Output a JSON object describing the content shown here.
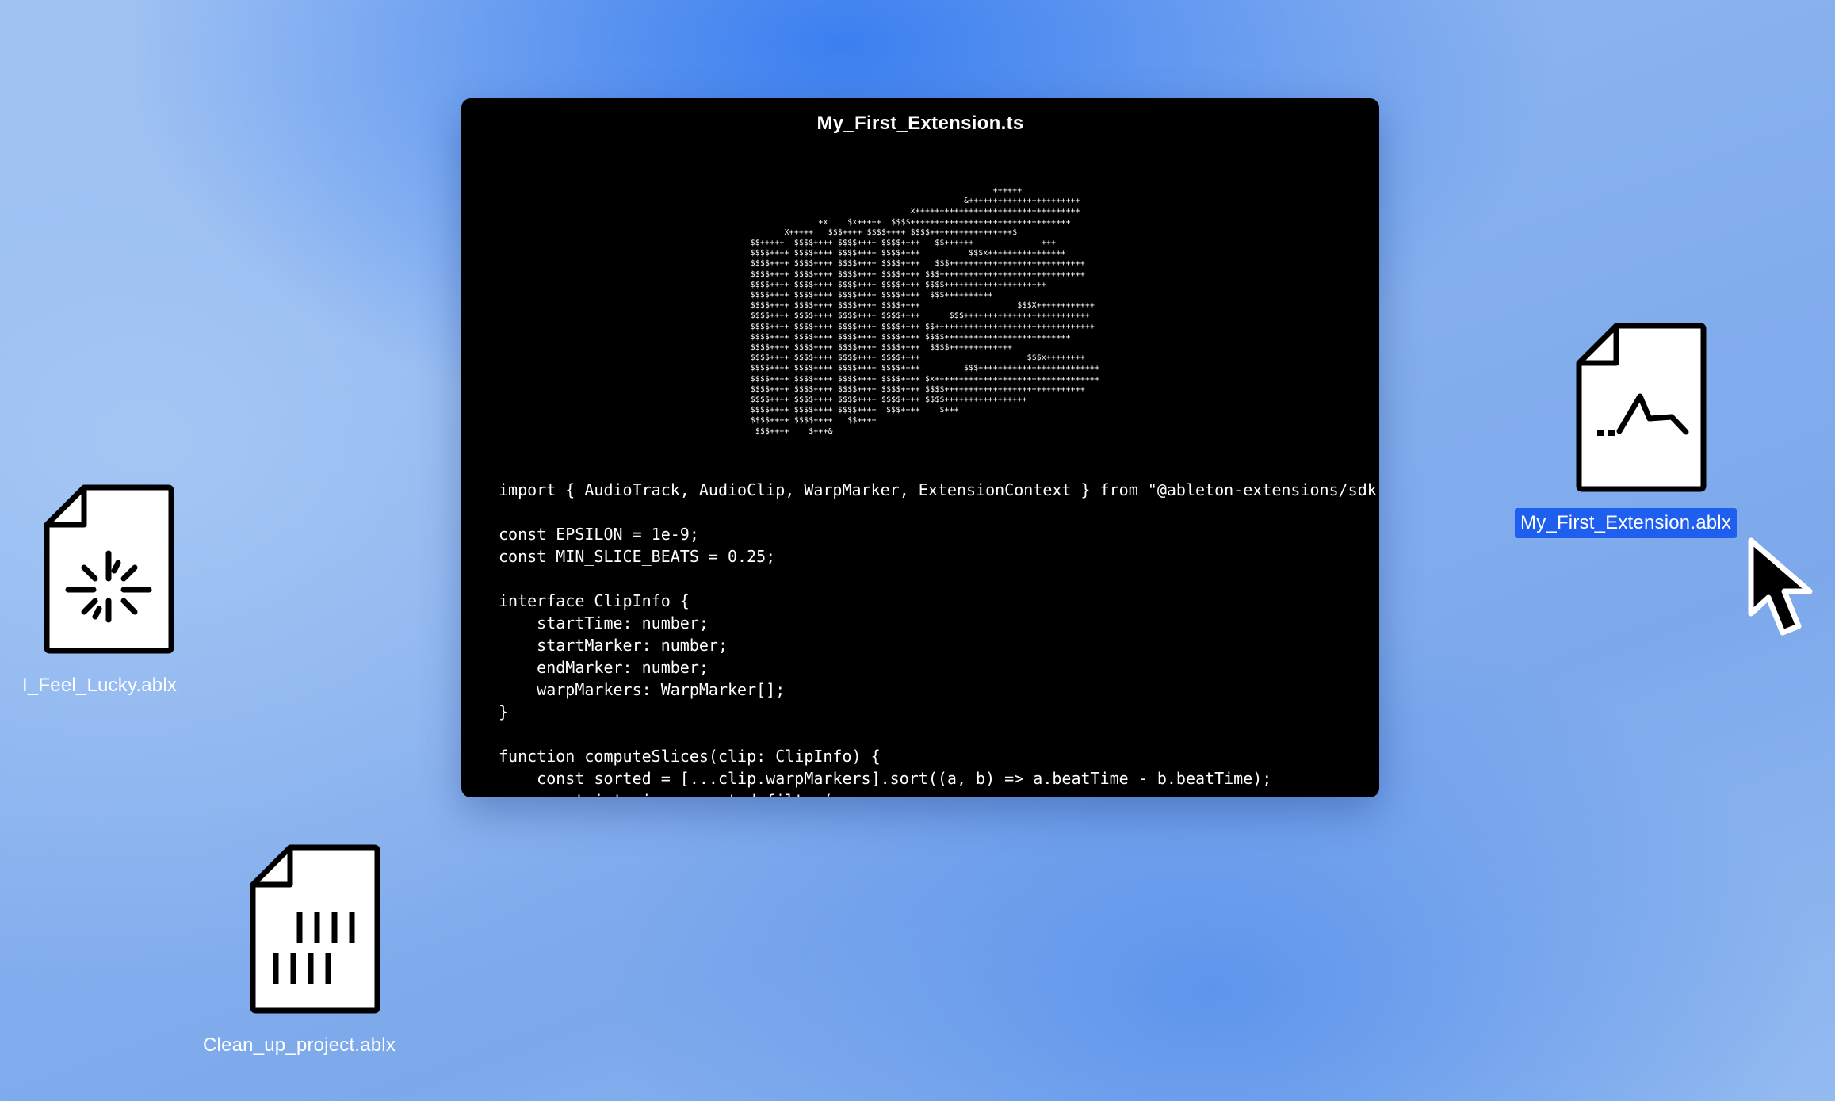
{
  "window": {
    "title": "My_First_Extension.ts",
    "ascii_art": "                                                    ++++++\n                                              &+++++++++++++++++++++++\n                                   x++++++++++++++++++++++++++++++++++\n                +x    $x+++++  $$$$+++++++++++++++++++++++++++++++++\n         X+++++   $$$++++ $$$$++++ $$$$+++++++++++++++++$\n  $$+++++  $$$$++++ $$$$++++ $$$$++++   $$++++++              +++\n  $$$$++++ $$$$++++ $$$$++++ $$$$++++          $$$x++++++++++++++++\n  $$$$++++ $$$$++++ $$$$++++ $$$$++++   $$$++++++++++++++++++++++++++++\n  $$$$++++ $$$$++++ $$$$++++ $$$$++++ $$$++++++++++++++++++++++++++++++\n  $$$$++++ $$$$++++ $$$$++++ $$$$++++ $$$$+++++++++++++++++++++\n  $$$$++++ $$$$++++ $$$$++++ $$$$++++  $$$++++++++++\n  $$$$++++ $$$$++++ $$$$++++ $$$$++++                    $$$X++++++++++++\n  $$$$++++ $$$$++++ $$$$++++ $$$$++++      $$$++++++++++++++++++++++++++\n  $$$$++++ $$$$++++ $$$$++++ $$$$++++ $$+++++++++++++++++++++++++++++++++\n  $$$$++++ $$$$++++ $$$$++++ $$$$++++ $$$$++++++++++++++++++++++++++\n  $$$$++++ $$$$++++ $$$$++++ $$$$++++  $$$$+++++++++++++\n  $$$$++++ $$$$++++ $$$$++++ $$$$++++                      $$$x++++++++\n  $$$$++++ $$$$++++ $$$$++++ $$$$++++         $$$+++++++++++++++++++++++++\n  $$$$++++ $$$$++++ $$$$++++ $$$$++++ $x++++++++++++++++++++++++++++++++++\n  $$$$++++ $$$$++++ $$$$++++ $$$$++++ $$$$+++++++++++++++++++++++++++++\n  $$$$++++ $$$$++++ $$$$++++ $$$$++++ $$$$+++++++++++++++++\n  $$$$++++ $$$$++++ $$$$++++  $$$++++    $+++\n  $$$$++++ $$$$++++   $$++++\n   $$$++++    $+++&",
    "code": "import { AudioTrack, AudioClip, WarpMarker, ExtensionContext } from \"@ableton-extensions/sdk\";\n\nconst EPSILON = 1e-9;\nconst MIN_SLICE_BEATS = 0.25;\n\ninterface ClipInfo {\n    startTime: number;\n    startMarker: number;\n    endMarker: number;\n    warpMarkers: WarpMarker[];\n}\n\nfunction computeSlices(clip: ClipInfo) {\n    const sorted = [...clip.warpMarkers].sort((a, b) => a.beatTime - b.beatTime);\n    const interior = sorted.filter("
  },
  "desktop": {
    "files": [
      {
        "label": "I_Feel_Lucky.ablx",
        "icon": "sparkle-document-icon"
      },
      {
        "label": "Clean_up_project.ablx",
        "icon": "barcode-document-icon"
      },
      {
        "label": "My_First_Extension.ablx",
        "icon": "waveform-document-icon",
        "selected": true
      }
    ]
  },
  "colors": {
    "selection": "#1f5ff0",
    "window_bg": "#000000"
  }
}
